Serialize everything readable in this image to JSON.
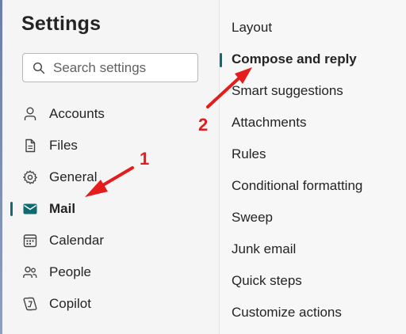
{
  "settings": {
    "title": "Settings",
    "search_placeholder": "Search settings"
  },
  "nav": {
    "items": [
      {
        "label": "Accounts",
        "icon": "person-icon"
      },
      {
        "label": "Files",
        "icon": "file-icon"
      },
      {
        "label": "General",
        "icon": "gear-icon"
      },
      {
        "label": "Mail",
        "icon": "mail-icon",
        "active": true
      },
      {
        "label": "Calendar",
        "icon": "calendar-icon"
      },
      {
        "label": "People",
        "icon": "people-icon"
      },
      {
        "label": "Copilot",
        "icon": "copilot-icon"
      }
    ]
  },
  "mail_sections": {
    "items": [
      {
        "label": "Layout"
      },
      {
        "label": "Compose and reply",
        "active": true
      },
      {
        "label": "Smart suggestions"
      },
      {
        "label": "Attachments"
      },
      {
        "label": "Rules"
      },
      {
        "label": "Conditional formatting"
      },
      {
        "label": "Sweep"
      },
      {
        "label": "Junk email"
      },
      {
        "label": "Quick steps"
      },
      {
        "label": "Customize actions"
      }
    ]
  },
  "annotations": {
    "one": "1",
    "two": "2",
    "arrow_color": "#e51c1c"
  },
  "colors": {
    "accent": "#0f6b72"
  }
}
